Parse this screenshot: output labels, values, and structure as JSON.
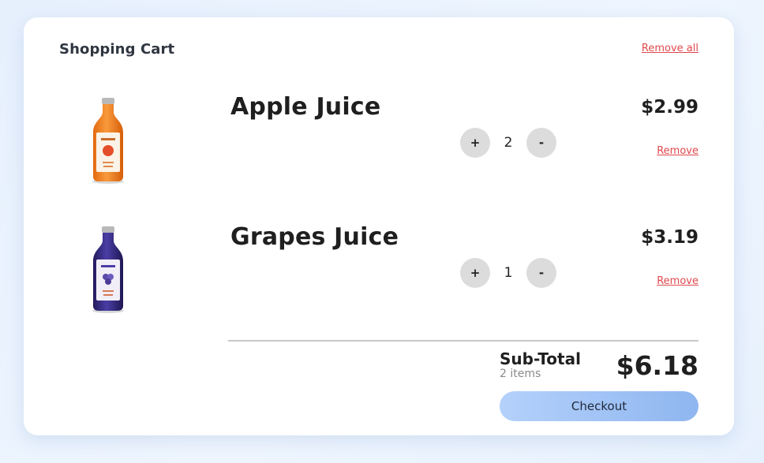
{
  "cart": {
    "title": "Shopping Cart",
    "remove_all_label": "Remove all",
    "items": [
      {
        "name": "Apple Juice",
        "price": "$2.99",
        "quantity": "2",
        "plus_label": "+",
        "minus_label": "-",
        "remove_label": "Remove",
        "bottle_color": "#f07b1e",
        "image_icon": "apple-juice-bottle-icon"
      },
      {
        "name": "Grapes Juice",
        "price": "$3.19",
        "quantity": "1",
        "plus_label": "+",
        "minus_label": "-",
        "remove_label": "Remove",
        "bottle_color": "#3a2f86",
        "image_icon": "grapes-juice-bottle-icon"
      }
    ],
    "summary": {
      "subtotal_label": "Sub-Total",
      "items_count": "2 items",
      "total": "$6.18",
      "checkout_label": "Checkout"
    }
  },
  "colors": {
    "accent": "#e0484c",
    "checkout_start": "#b4d1fb",
    "checkout_end": "#8fb6f0",
    "background": "#e6f0fd"
  }
}
